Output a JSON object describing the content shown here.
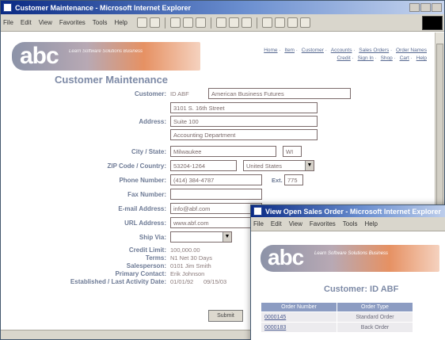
{
  "main_window": {
    "title": "Customer Maintenance - Microsoft Internet Explorer",
    "menu": [
      "File",
      "Edit",
      "View",
      "Favorites",
      "Tools",
      "Help"
    ]
  },
  "logo": {
    "text": "abc",
    "tagline": "Learn Software Solutions Business"
  },
  "nav_links": {
    "line1": [
      "Home",
      "Item",
      "Customer",
      "Accounts",
      "Sales Orders",
      "Order Names"
    ],
    "line2": [
      "Credit",
      "Sign In",
      "Shop",
      "Cart",
      "Help"
    ]
  },
  "page_title": "Customer Maintenance",
  "form": {
    "customer_label": "Customer:",
    "customer_id": "ID ABF",
    "customer_name": "American Business Futures",
    "address_label": "Address:",
    "address_lines": [
      "3101 S. 16th Street",
      "Suite 100",
      "Accounting Department"
    ],
    "city_state_label": "City / State:",
    "city": "Milwaukee",
    "state": "WI",
    "zip_country_label": "ZIP Code / Country:",
    "zip": "53204-1264",
    "country": "United States",
    "phone_label": "Phone Number:",
    "phone": "(414) 384-4787",
    "ext_label": "Ext.",
    "ext": "775",
    "fax_label": "Fax Number:",
    "fax": "",
    "email_label": "E-mail Address:",
    "email": "info@abf.com",
    "url_label": "URL Address:",
    "url": "www.abf.com",
    "ship_via_label": "Ship Via:",
    "ship_via": "",
    "credit_limit_label": "Credit Limit:",
    "credit_limit": "100,000.00",
    "terms_label": "Terms:",
    "terms": "N1  Net 30 Days",
    "salesperson_label": "Salesperson:",
    "salesperson": "0101  Jim Smith",
    "primary_contact_label": "Primary Contact:",
    "primary_contact": "Erik Johnson",
    "established_label": "Established / Last Activity Date:",
    "established": "01/01/92",
    "last_activity": "09/15/03",
    "submit_label": "Submit"
  },
  "order_window": {
    "title": "View Open Sales Order - Microsoft Internet Explorer",
    "menu": [
      "File",
      "Edit",
      "View",
      "Favorites",
      "Tools",
      "Help"
    ],
    "heading": "Customer:  ID  ABF",
    "columns": [
      "Order Number",
      "Order Type"
    ],
    "rows": [
      {
        "number": "0000145",
        "type": "Standard Order"
      },
      {
        "number": "0000183",
        "type": "Back Order"
      }
    ]
  },
  "colors": {
    "title_blue": "#7d8aa6",
    "label_blue": "#6d7a95",
    "table_header": "#8c9cc2",
    "logo_orange": "#e69163"
  }
}
